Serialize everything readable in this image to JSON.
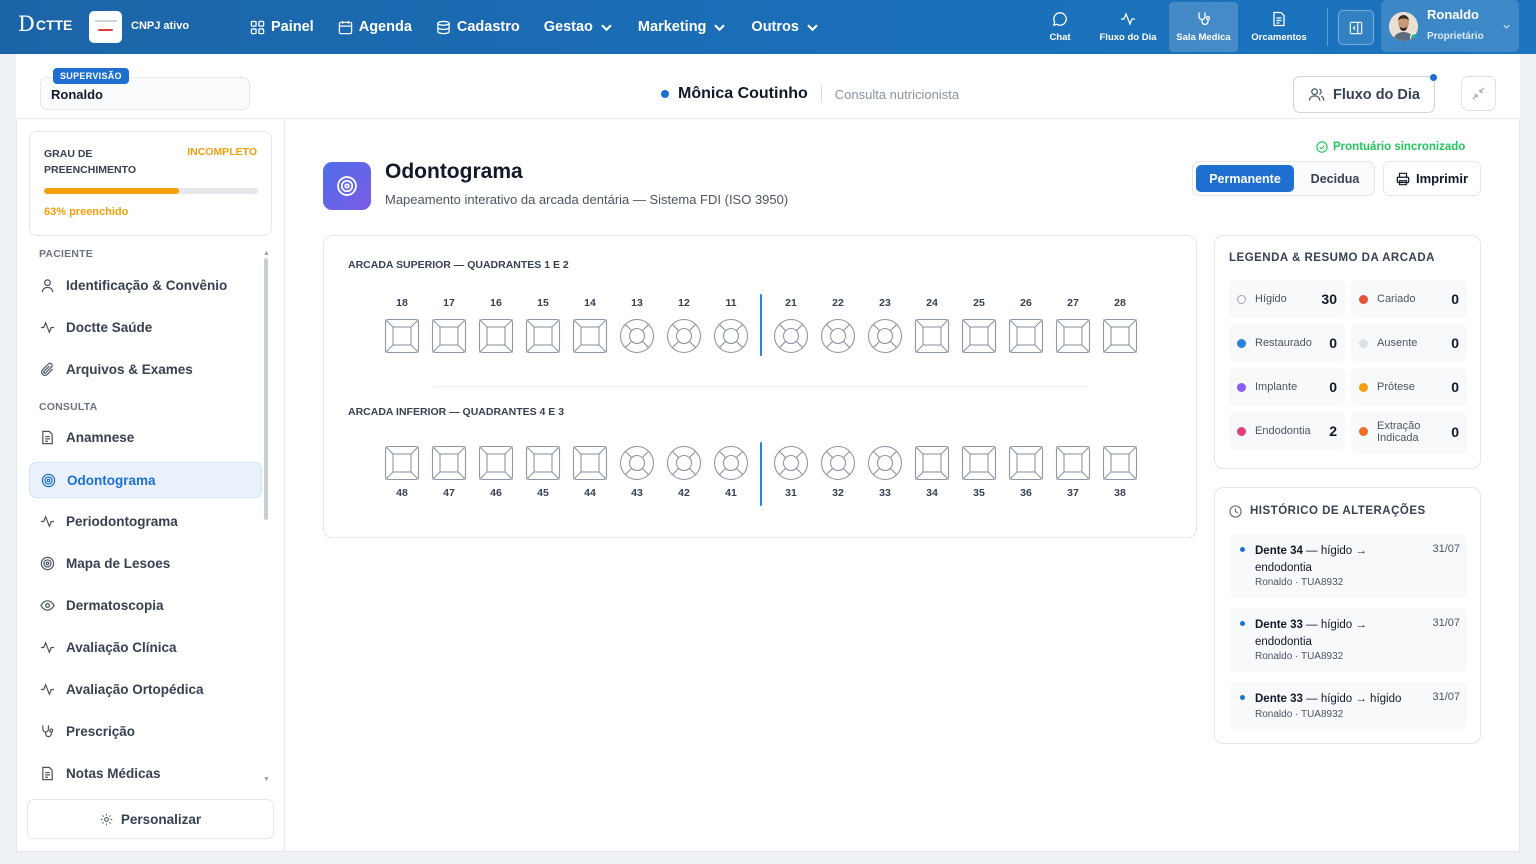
{
  "topbar": {
    "logo_text": "CTTE",
    "logo_initial": "D",
    "cnpj_status": "CNPJ ativo",
    "nav": [
      {
        "label": "Painel",
        "icon": "grid-icon",
        "dropdown": false
      },
      {
        "label": "Agenda",
        "icon": "calendar-icon",
        "dropdown": false
      },
      {
        "label": "Cadastro",
        "icon": "database-icon",
        "dropdown": false
      },
      {
        "label": "Gestao",
        "dropdown": true
      },
      {
        "label": "Marketing",
        "dropdown": true
      },
      {
        "label": "Outros",
        "dropdown": true
      }
    ],
    "right_nav": [
      {
        "label": "Chat",
        "icon": "chat-icon"
      },
      {
        "label": "Fluxo do Dia",
        "icon": "activity-icon"
      },
      {
        "label": "Sala Medica",
        "icon": "stethoscope-icon",
        "active": true
      },
      {
        "label": "Orcamentos",
        "icon": "document-icon"
      }
    ],
    "user": {
      "name": "Ronaldo",
      "role": "Proprietário"
    }
  },
  "subheader": {
    "supervision_badge": "SUPERVISÃO",
    "supervisor_name": "Ronaldo",
    "patient_name": "Mônica Coutinho",
    "consultation_type": "Consulta nutricionista",
    "fluxo_button": "Fluxo do Dia"
  },
  "sidebar": {
    "progress": {
      "label": "GRAU DE PREENCHIMENTO",
      "status": "INCOMPLETO",
      "percent": 63,
      "percent_text": "63% preenchido"
    },
    "section_patient": "PACIENTE",
    "section_consult": "CONSULTA",
    "patient_items": [
      {
        "label": "Identificação & Convênio",
        "icon": "user-icon"
      },
      {
        "label": "Doctte Saúde",
        "icon": "pulse-icon"
      },
      {
        "label": "Arquivos & Exames",
        "icon": "paperclip-icon"
      }
    ],
    "consult_items": [
      {
        "label": "Anamnese",
        "icon": "document-icon"
      },
      {
        "label": "Odontograma",
        "icon": "target-icon",
        "active": true
      },
      {
        "label": "Periodontograma",
        "icon": "pulse-icon"
      },
      {
        "label": "Mapa de Lesoes",
        "icon": "target-icon"
      },
      {
        "label": "Dermatoscopia",
        "icon": "eye-icon"
      },
      {
        "label": "Avaliação Clínica",
        "icon": "pulse-icon"
      },
      {
        "label": "Avaliação Ortopédica",
        "icon": "pulse-icon"
      },
      {
        "label": "Prescrição",
        "icon": "stethoscope-icon"
      },
      {
        "label": "Notas Médicas",
        "icon": "document-icon"
      }
    ],
    "personalize_label": "Personalizar"
  },
  "content": {
    "title": "Odontograma",
    "subtitle": "Mapeamento interativo da arcada dentária — Sistema FDI (ISO 3950)",
    "sync_status": "Prontuário sincronizado",
    "dentition_options": [
      "Permanente",
      "Decidua"
    ],
    "dentition_selected": "Permanente",
    "print_label": "Imprimir",
    "upper_arch_title": "ARCADA SUPERIOR — QUADRANTES 1 E 2",
    "lower_arch_title": "ARCADA INFERIOR — QUADRANTES 4 E 3",
    "upper_teeth": [
      {
        "n": "18",
        "shape": "molar"
      },
      {
        "n": "17",
        "shape": "molar"
      },
      {
        "n": "16",
        "shape": "molar"
      },
      {
        "n": "15",
        "shape": "molar"
      },
      {
        "n": "14",
        "shape": "molar"
      },
      {
        "n": "13",
        "shape": "round"
      },
      {
        "n": "12",
        "shape": "round"
      },
      {
        "n": "11",
        "shape": "round"
      },
      {
        "n": "21",
        "shape": "round"
      },
      {
        "n": "22",
        "shape": "round"
      },
      {
        "n": "23",
        "shape": "round"
      },
      {
        "n": "24",
        "shape": "molar"
      },
      {
        "n": "25",
        "shape": "molar"
      },
      {
        "n": "26",
        "shape": "molar"
      },
      {
        "n": "27",
        "shape": "molar"
      },
      {
        "n": "28",
        "shape": "molar"
      }
    ],
    "lower_teeth": [
      {
        "n": "48",
        "shape": "molar"
      },
      {
        "n": "47",
        "shape": "molar"
      },
      {
        "n": "46",
        "shape": "molar"
      },
      {
        "n": "45",
        "shape": "molar"
      },
      {
        "n": "44",
        "shape": "molar"
      },
      {
        "n": "43",
        "shape": "round"
      },
      {
        "n": "42",
        "shape": "round"
      },
      {
        "n": "41",
        "shape": "round"
      },
      {
        "n": "31",
        "shape": "round"
      },
      {
        "n": "32",
        "shape": "round"
      },
      {
        "n": "33",
        "shape": "round"
      },
      {
        "n": "34",
        "shape": "molar"
      },
      {
        "n": "35",
        "shape": "molar"
      },
      {
        "n": "36",
        "shape": "molar"
      },
      {
        "n": "37",
        "shape": "molar"
      },
      {
        "n": "38",
        "shape": "molar"
      }
    ]
  },
  "legend": {
    "title": "LEGENDA & RESUMO DA ARCADA",
    "items": [
      {
        "label": "Hígido",
        "value": "30",
        "color": "#ffffff",
        "border": "#9ca3af"
      },
      {
        "label": "Cariado",
        "value": "0",
        "color": "#e5533d"
      },
      {
        "label": "Restaurado",
        "value": "0",
        "color": "#2f7fe0"
      },
      {
        "label": "Ausente",
        "value": "0",
        "color": "#dbe2ea"
      },
      {
        "label": "Implante",
        "value": "0",
        "color": "#8b5cf6"
      },
      {
        "label": "Prótese",
        "value": "0",
        "color": "#f59e0b"
      },
      {
        "label": "Endodontia",
        "value": "2",
        "color": "#e43f7a"
      },
      {
        "label": "Extração Indicada",
        "value": "0",
        "color": "#f06b2a"
      }
    ]
  },
  "history": {
    "title": "HISTÓRICO DE ALTERAÇÕES",
    "items": [
      {
        "tooth": "Dente 34",
        "change": " — hígido → endodontia",
        "date": "31/07",
        "meta": "Ronaldo · TUA8932"
      },
      {
        "tooth": "Dente 33",
        "change": " — hígido → endodontia",
        "date": "31/07",
        "meta": "Ronaldo · TUA8932"
      },
      {
        "tooth": "Dente 33",
        "change": " — hígido → hígido",
        "date": "31/07",
        "meta": "Ronaldo · TUA8932"
      }
    ]
  },
  "colors": {
    "primary": "#1f6fd1",
    "warning": "#f59e0b",
    "success": "#22c55e",
    "topbar": "#1c6bb4"
  }
}
